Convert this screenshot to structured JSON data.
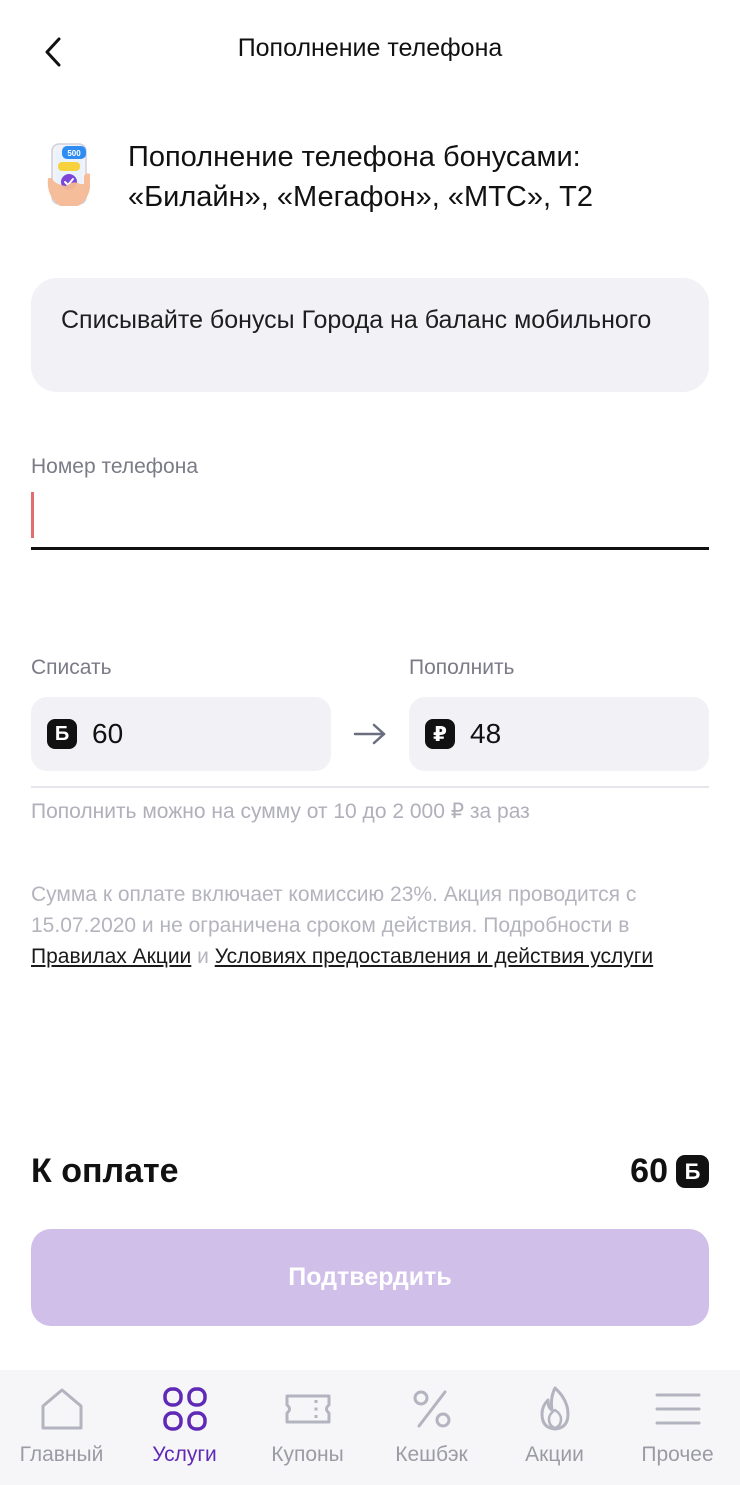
{
  "header": {
    "title": "Пополнение телефона",
    "back_icon": "chevron-left-icon"
  },
  "service": {
    "icon": "phone-topup-icon",
    "icon_badge": "500",
    "title_line1": "Пополнение телефона бонусами:",
    "title_line2": "«Билайн», «Мегафон», «МТС», Т2"
  },
  "info_card": {
    "text": "Списывайте бонусы Города на баланс мобильного"
  },
  "phone_field": {
    "label": "Номер телефона",
    "value": "",
    "placeholder": ""
  },
  "amounts": {
    "debit_label": "Списать",
    "debit_badge": "Б",
    "debit_value": "60",
    "credit_label": "Пополнить",
    "credit_badge": "₽",
    "credit_value": "48",
    "arrow_icon": "arrow-right-icon",
    "range_note": "Пополнить можно на сумму от 10 до 2 000 ₽ за раз"
  },
  "terms": {
    "text_1": "Сумма к оплате включает комиссию 23%. Акция проводится с 15.07.2020 и не ограничена сроком действия. Подробности в ",
    "link_rules": "Правилах Акции",
    "text_and": " и ",
    "link_conditions": "Условиях предоставления и действия услуги"
  },
  "total": {
    "label": "К оплате",
    "value": "60",
    "badge": "Б"
  },
  "confirm_button": {
    "label": "Подтвердить",
    "enabled": false
  },
  "colors": {
    "accent": "#5f2ab5",
    "button_disabled": "#d0bfe9",
    "card_bg": "#f1f1f6",
    "caret": "#e26d70"
  },
  "bottom_nav": {
    "active": "services",
    "items": [
      {
        "id": "home",
        "label": "Главный",
        "icon": "home-icon"
      },
      {
        "id": "services",
        "label": "Услуги",
        "icon": "grid-icon"
      },
      {
        "id": "coupons",
        "label": "Купоны",
        "icon": "ticket-icon"
      },
      {
        "id": "cashback",
        "label": "Кешбэк",
        "icon": "percent-icon"
      },
      {
        "id": "promos",
        "label": "Акции",
        "icon": "flame-icon"
      },
      {
        "id": "more",
        "label": "Прочее",
        "icon": "menu-icon"
      }
    ]
  }
}
